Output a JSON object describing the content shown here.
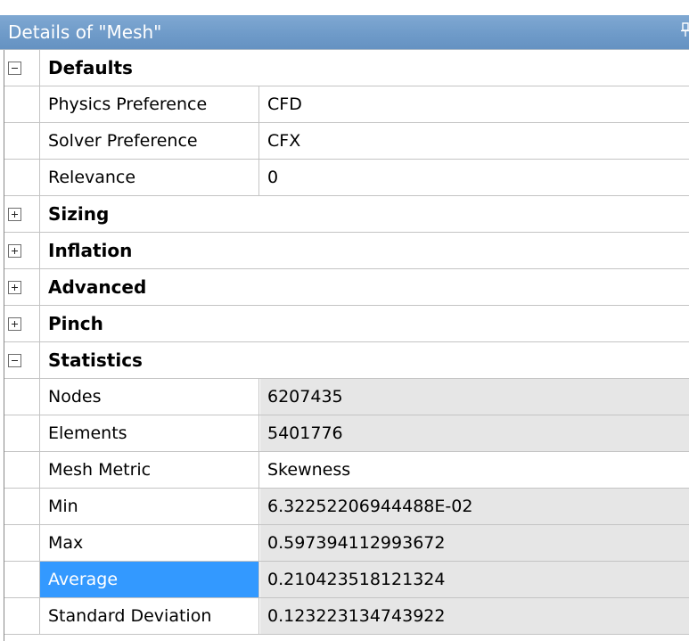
{
  "panel": {
    "title": "Details of \"Mesh\"",
    "pin_icon": "pin-icon"
  },
  "groups": {
    "defaults": {
      "label": "Defaults",
      "expanded": true,
      "rows": {
        "physics_preference": {
          "name": "Physics Preference",
          "value": "CFD"
        },
        "solver_preference": {
          "name": "Solver Preference",
          "value": "CFX"
        },
        "relevance": {
          "name": "Relevance",
          "value": "0"
        }
      }
    },
    "sizing": {
      "label": "Sizing",
      "expanded": false
    },
    "inflation": {
      "label": "Inflation",
      "expanded": false
    },
    "advanced": {
      "label": "Advanced",
      "expanded": false
    },
    "pinch": {
      "label": "Pinch",
      "expanded": false
    },
    "statistics": {
      "label": "Statistics",
      "expanded": true,
      "rows": {
        "nodes": {
          "name": "Nodes",
          "value": "6207435"
        },
        "elements": {
          "name": "Elements",
          "value": "5401776"
        },
        "mesh_metric": {
          "name": "Mesh Metric",
          "value": "Skewness"
        },
        "min": {
          "name": "Min",
          "value": "6.32252206944488E-02"
        },
        "max": {
          "name": "Max",
          "value": "0.597394112993672"
        },
        "average": {
          "name": "Average",
          "value": "0.210423518121324"
        },
        "standard_deviation": {
          "name": "Standard Deviation",
          "value": "0.123223134743922"
        }
      }
    }
  },
  "selection": {
    "selected_row": "Average",
    "highlight_color": "#3399ff"
  },
  "colors": {
    "titlebar": "#6f9bc9",
    "readonly_cell": "#e6e6e6",
    "grid_line": "#c4c4c4"
  }
}
